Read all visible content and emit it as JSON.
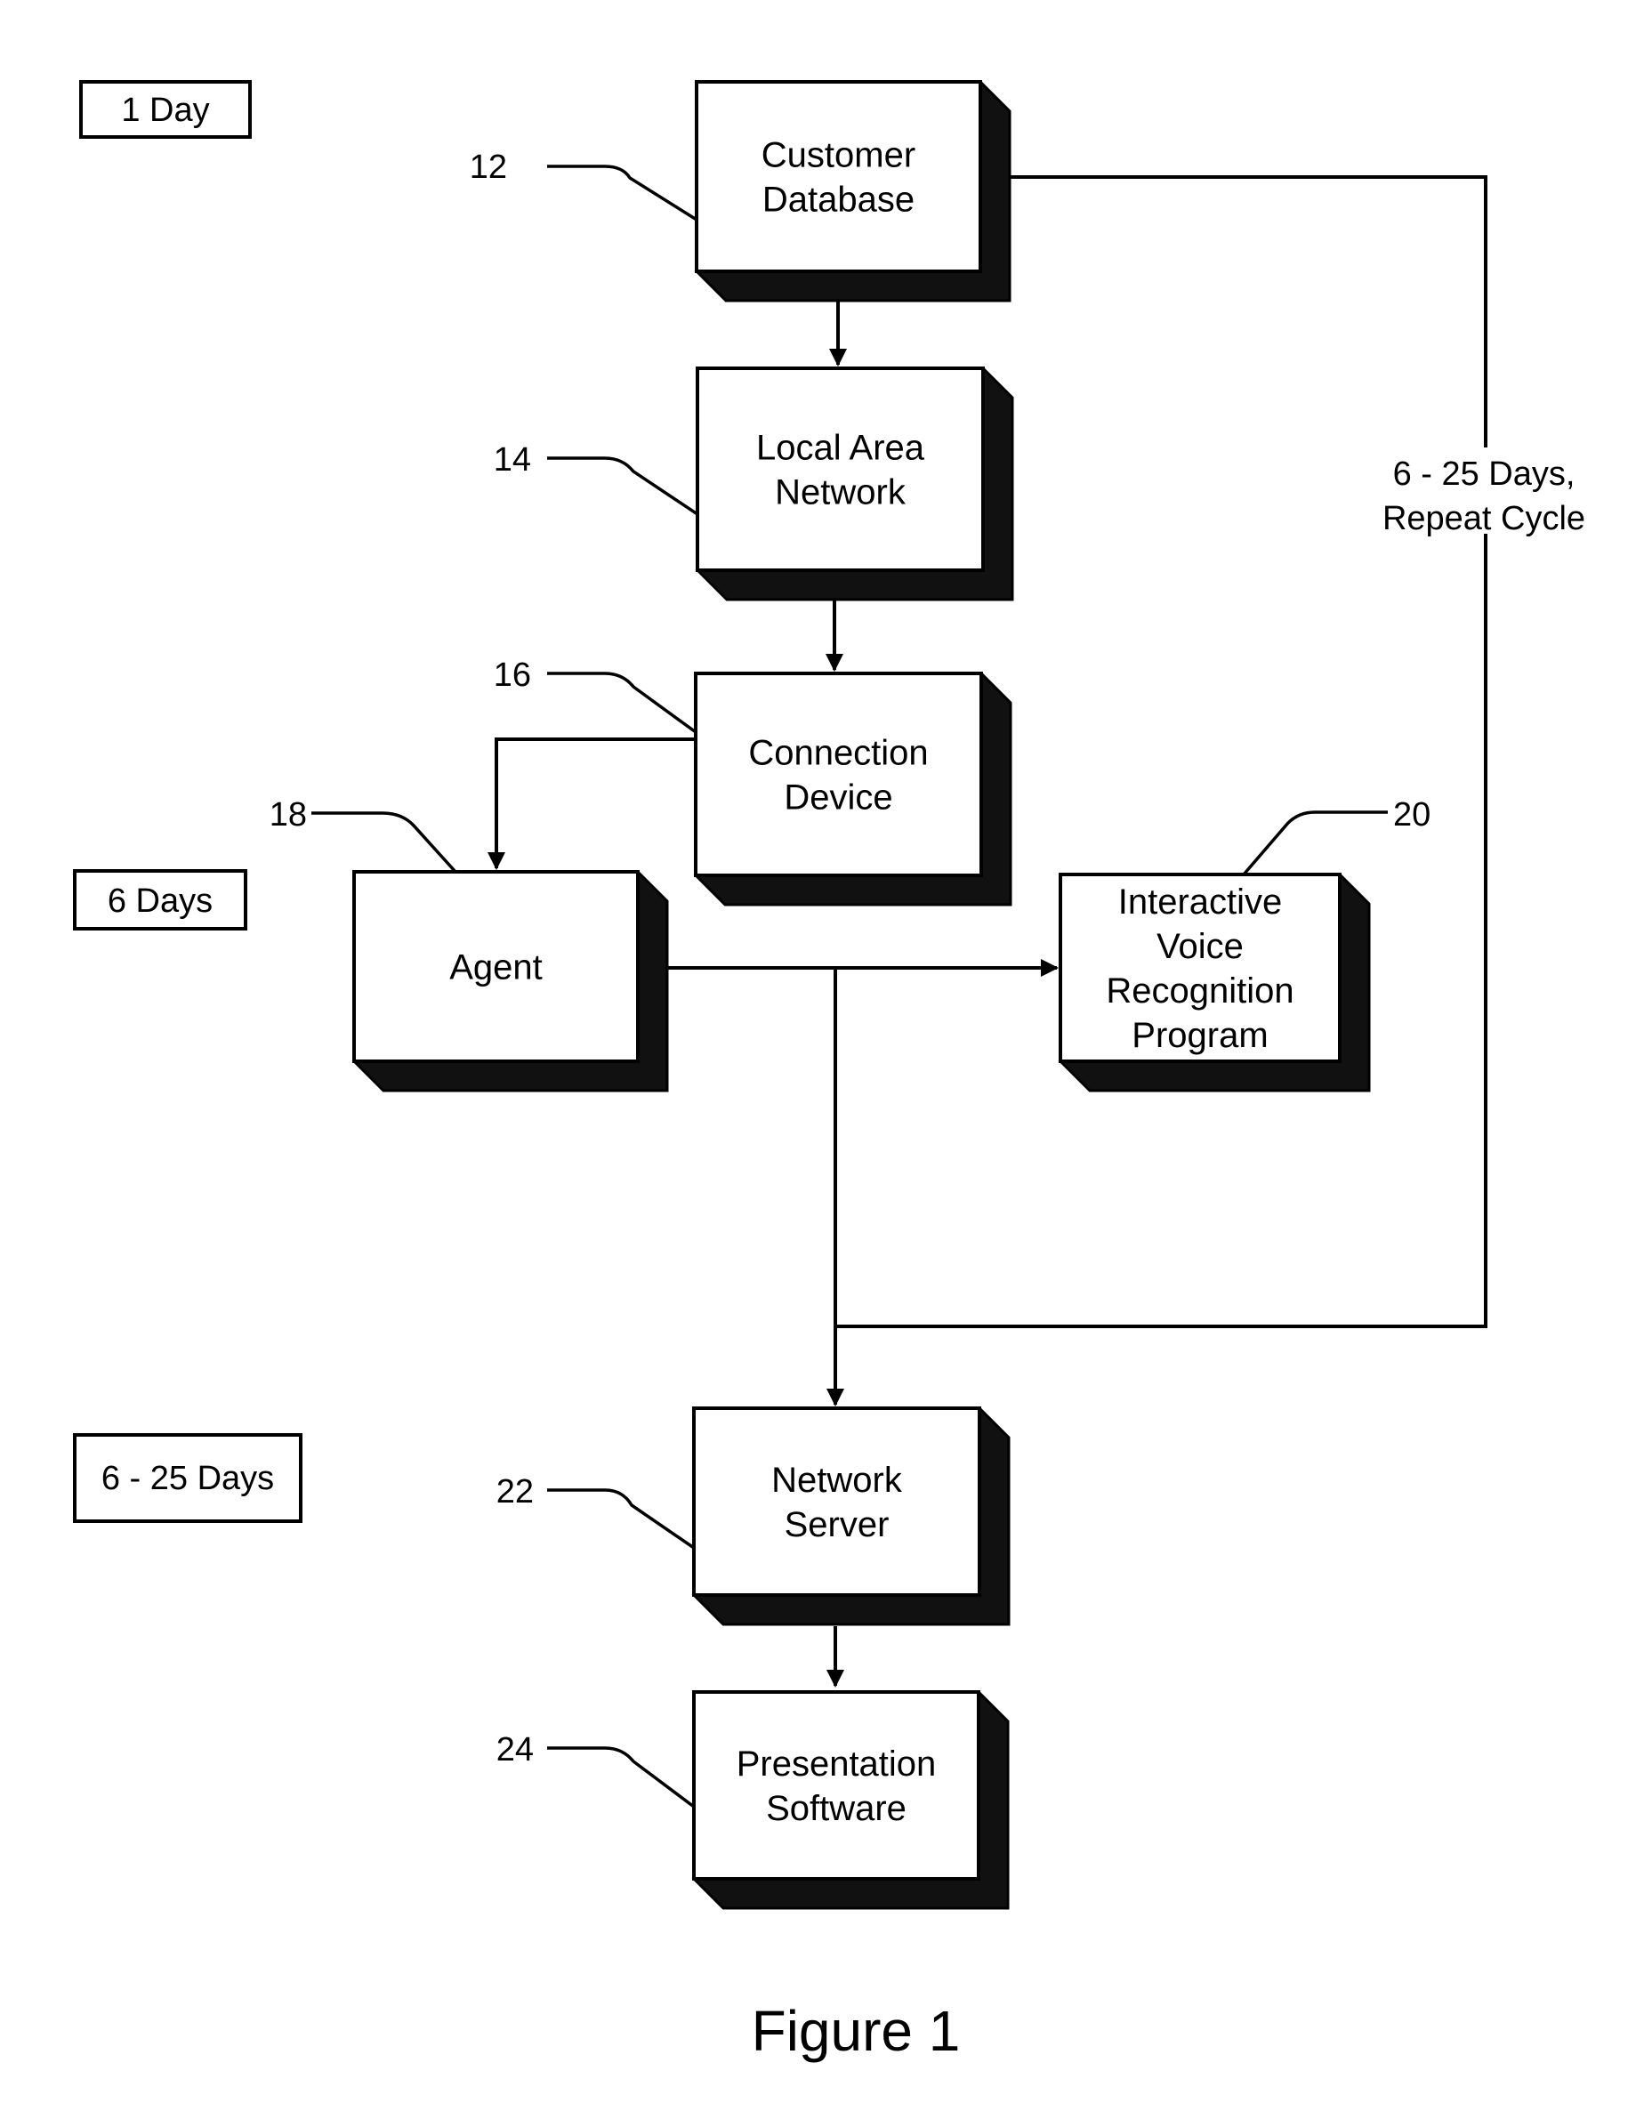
{
  "figure_caption": "Figure 1",
  "time_periods": [
    {
      "id": "period-1",
      "label": "1 Day"
    },
    {
      "id": "period-2",
      "label": "6 Days"
    },
    {
      "id": "period-3",
      "label": "6 - 25 Days"
    }
  ],
  "loop_label": [
    "6 - 25 Days,",
    "Repeat Cycle"
  ],
  "blocks": [
    {
      "id": "customer-database",
      "ref": "12",
      "lines": [
        "Customer",
        "Database"
      ]
    },
    {
      "id": "local-area-network",
      "ref": "14",
      "lines": [
        "Local Area",
        "Network"
      ]
    },
    {
      "id": "connection-device",
      "ref": "16",
      "lines": [
        "Connection",
        "Device"
      ]
    },
    {
      "id": "agent",
      "ref": "18",
      "lines": [
        "Agent"
      ]
    },
    {
      "id": "ivr-program",
      "ref": "20",
      "lines": [
        "Interactive",
        "Voice",
        "Recognition",
        "Program"
      ]
    },
    {
      "id": "network-server",
      "ref": "22",
      "lines": [
        "Network",
        "Server"
      ]
    },
    {
      "id": "presentation-software",
      "ref": "24",
      "lines": [
        "Presentation",
        "Software"
      ]
    }
  ],
  "colors": {
    "ink": "#000000",
    "background": "#ffffff",
    "shadow": "#111111"
  }
}
